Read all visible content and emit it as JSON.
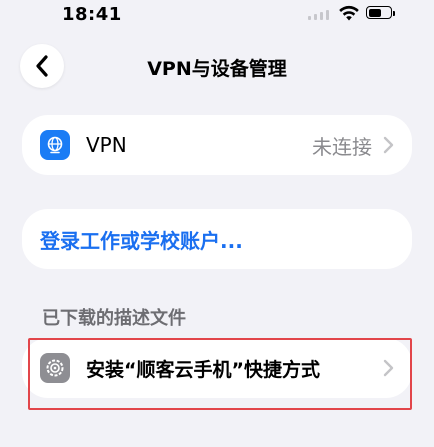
{
  "status_bar": {
    "time": "18:41"
  },
  "nav": {
    "title": "VPN与设备管理"
  },
  "vpn_row": {
    "label": "VPN",
    "value": "未连接"
  },
  "login_row": {
    "label": "登录工作或学校账户..."
  },
  "profiles_section": {
    "header": "已下载的描述文件",
    "item_label": "安装“顺客云手机”快捷方式"
  },
  "colors": {
    "accent_blue": "#1a6ff0",
    "highlight_red": "#e2454a",
    "background": "#f2f2f7"
  }
}
